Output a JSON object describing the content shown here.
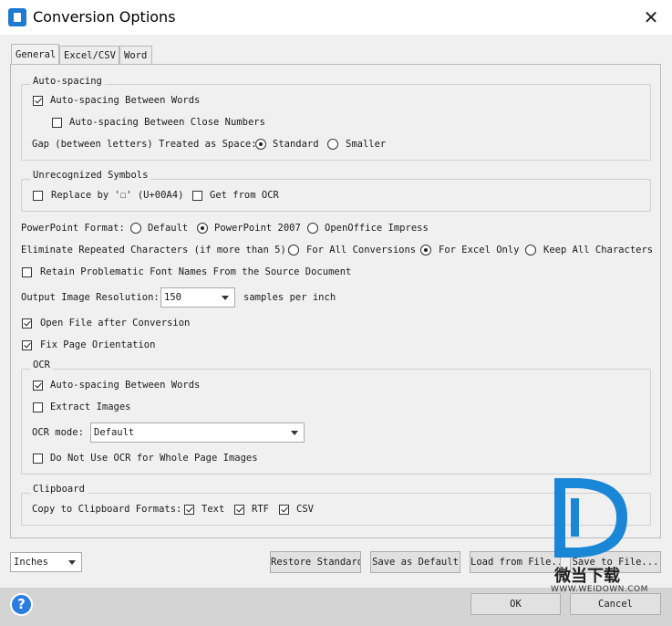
{
  "window": {
    "title": "Conversion Options",
    "close_glyph": "✕",
    "icon": "app-icon"
  },
  "tabs": [
    "General",
    "Excel/CSV",
    "Word"
  ],
  "autospacing": {
    "legend": "Auto-spacing",
    "between_words": "Auto-spacing Between Words",
    "between_close_numbers": "Auto-spacing Between Close Numbers",
    "gap_label": "Gap (between letters) Treated as Space:",
    "gap_standard": "Standard",
    "gap_smaller": "Smaller"
  },
  "unrecognized": {
    "legend": "Unrecognized Symbols",
    "replace_by": "Replace by '☐' (U+00A4)",
    "get_from_ocr": "Get from OCR"
  },
  "powerpoint": {
    "label": "PowerPoint Format:",
    "default": "Default",
    "pp2007": "PowerPoint 2007",
    "openoffice": "OpenOffice Impress"
  },
  "eliminate": {
    "label": "Eliminate Repeated Characters (if more than 5):",
    "all": "For All Conversions",
    "excel": "For Excel Only",
    "keep": "Keep All Characters"
  },
  "retain_fonts": "Retain Problematic Font Names From the Source Document",
  "resolution": {
    "label": "Output Image Resolution:",
    "value": "150",
    "suffix": "samples per inch"
  },
  "open_after": "Open File after Conversion",
  "fix_orientation": "Fix Page Orientation",
  "ocr": {
    "legend": "OCR",
    "between_words": "Auto-spacing Between Words",
    "extract_images": "Extract Images",
    "mode_label": "OCR mode:",
    "mode_value": "Default",
    "no_whole_page": "Do Not Use OCR for Whole Page Images"
  },
  "clipboard": {
    "legend": "Clipboard",
    "label": "Copy to Clipboard Formats:",
    "text": "Text",
    "rtf": "RTF",
    "csv": "CSV"
  },
  "bottom": {
    "units": "Inches",
    "restore": "Restore Standard",
    "save_default": "Save as Default",
    "load_file": "Load from File...",
    "save_file": "Save to File..."
  },
  "footer": {
    "help": "?",
    "ok": "OK",
    "cancel": "Cancel"
  },
  "watermark": {
    "cn": "微当下载",
    "en": "WWW.WEIDOWN.COM"
  },
  "colors": {
    "accent": "#1e7bd1",
    "watermark_blue": "#1a87d6"
  }
}
